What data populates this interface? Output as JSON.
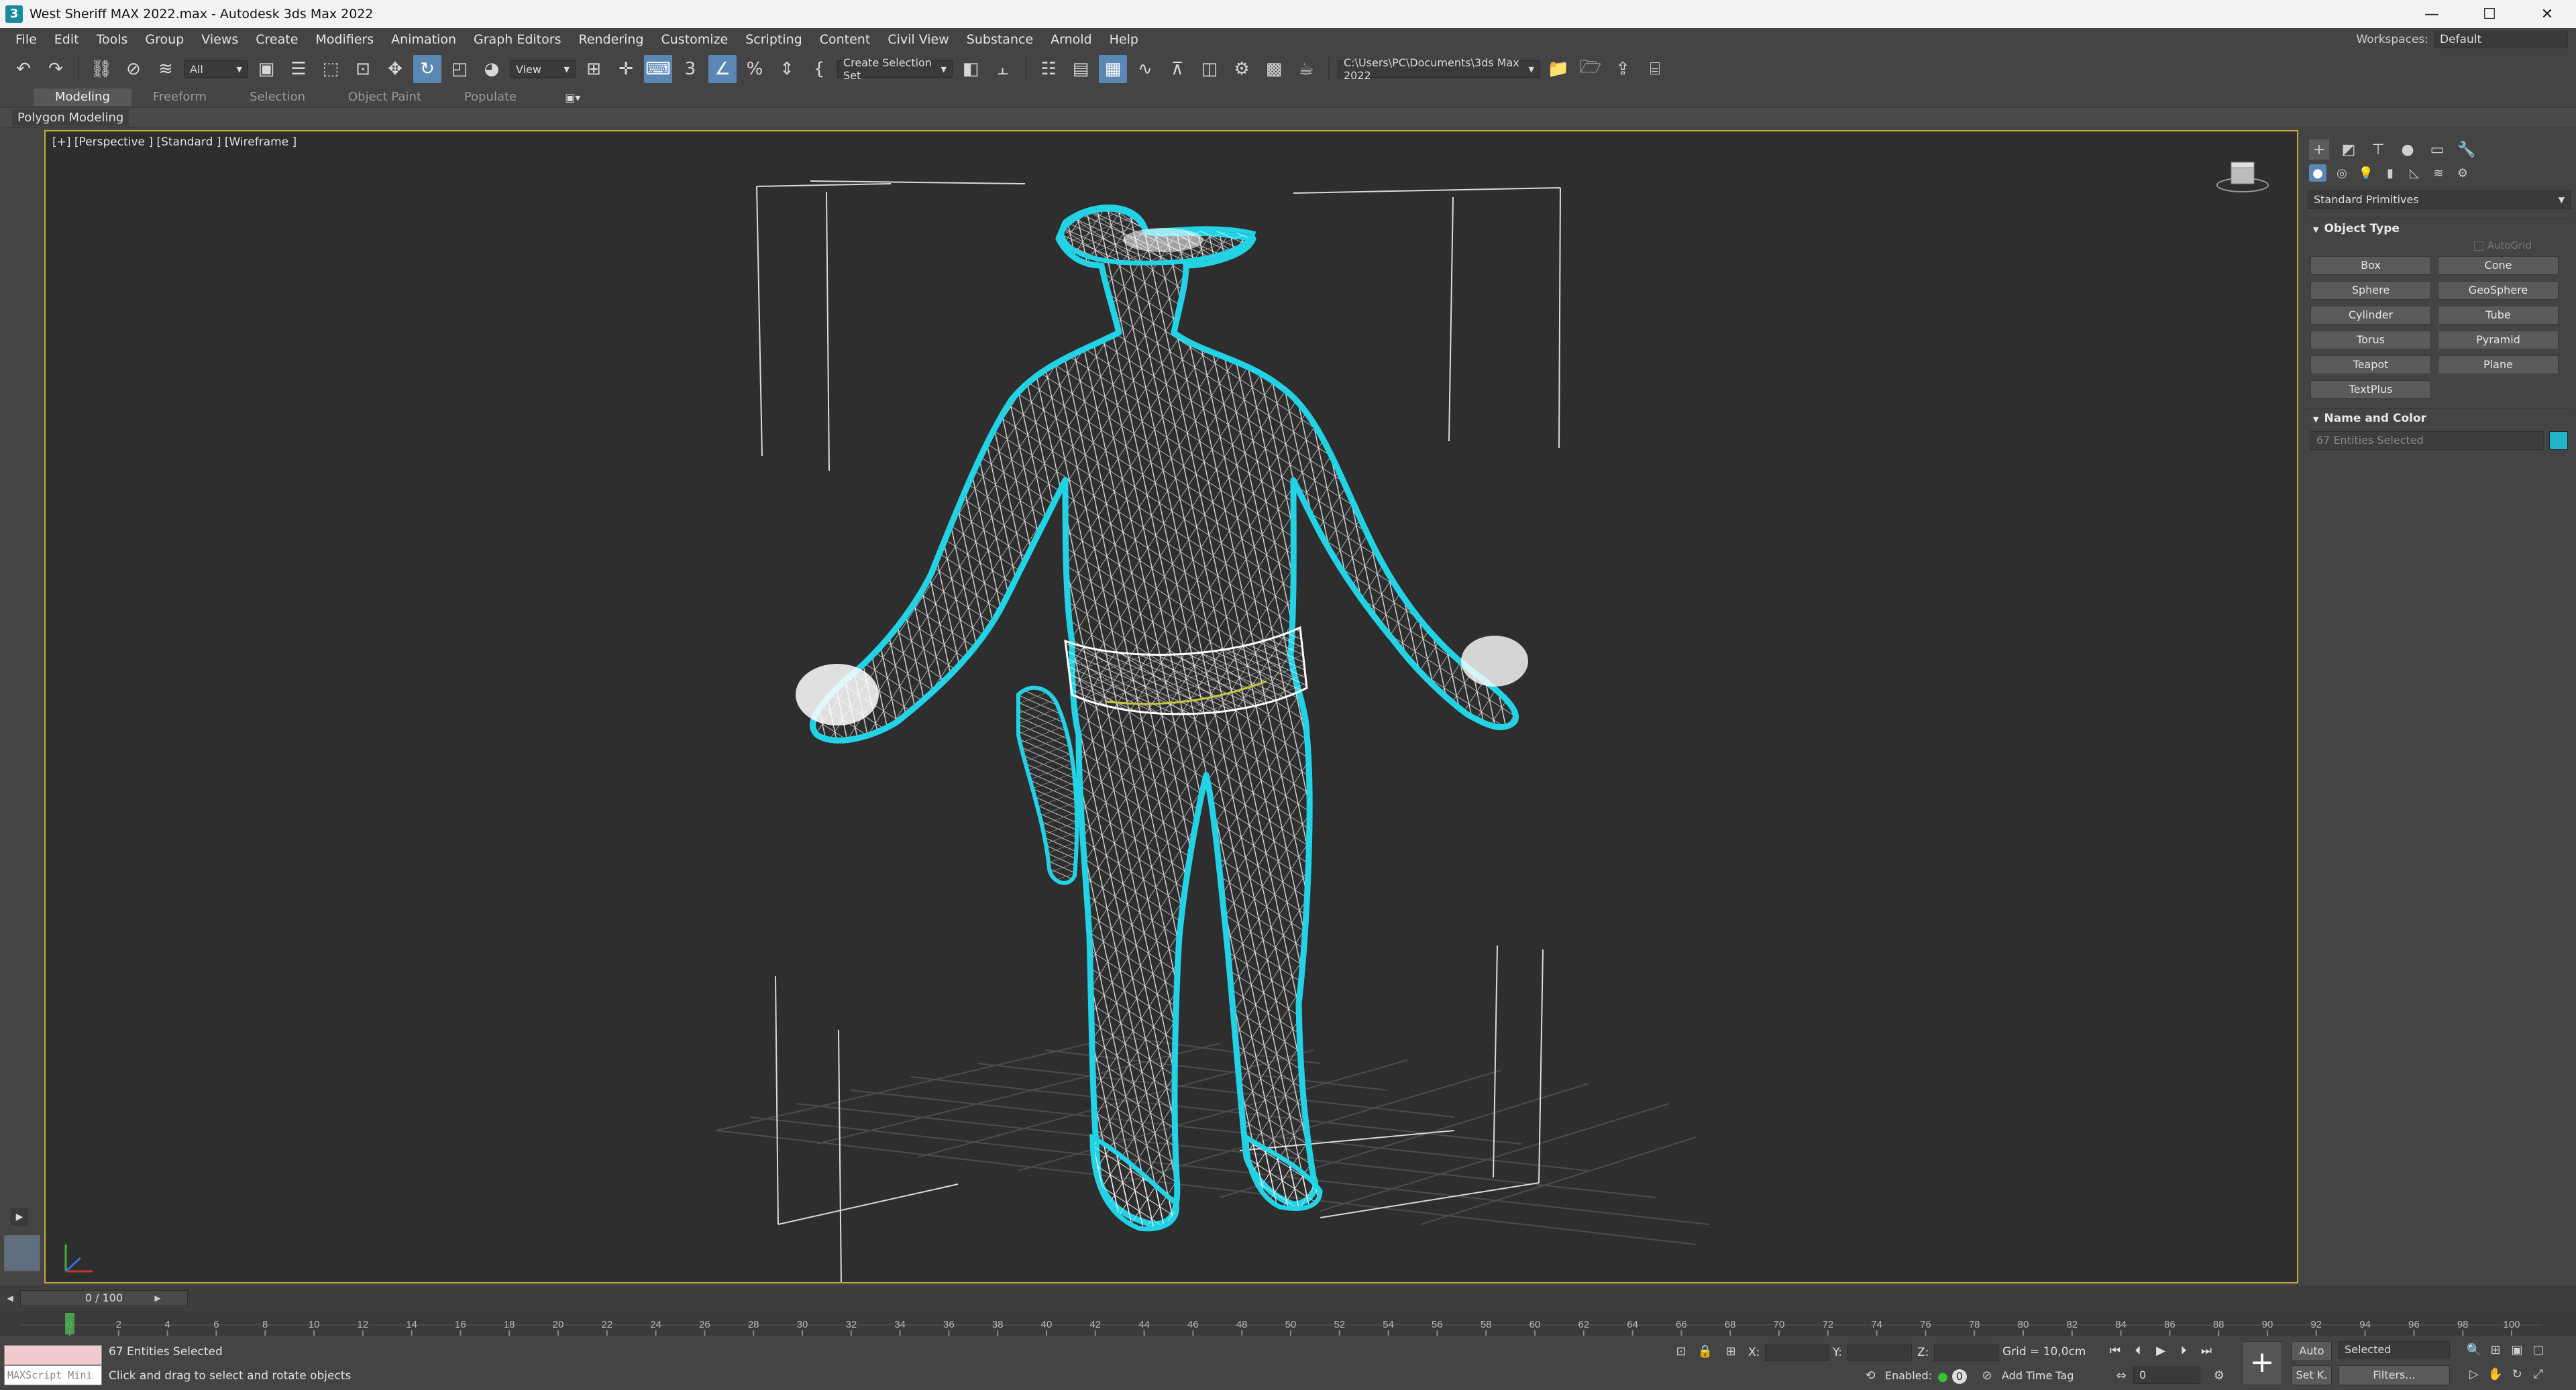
{
  "window": {
    "title": "West Sheriff MAX 2022.max - Autodesk 3ds Max 2022",
    "controls": [
      "—",
      "☐",
      "✕"
    ]
  },
  "menubar": {
    "items": [
      "File",
      "Edit",
      "Tools",
      "Group",
      "Views",
      "Create",
      "Modifiers",
      "Animation",
      "Graph Editors",
      "Rendering",
      "Customize",
      "Scripting",
      "Content",
      "Civil View",
      "Substance",
      "Arnold",
      "Help"
    ],
    "workspaces_label": "Workspaces:",
    "workspace_value": "Default"
  },
  "toolbar": {
    "selection_filter": "All",
    "ref_coord": "View",
    "named_selection_set": "Create Selection Set",
    "project_path": "C:\\Users\\PC\\Documents\\3ds Max 2022"
  },
  "ribbon": {
    "tabs": [
      "Modeling",
      "Freeform",
      "Selection",
      "Object Paint",
      "Populate"
    ],
    "active_tab": "Modeling",
    "panel_label": "Polygon Modeling"
  },
  "viewport": {
    "label": "[+] [Perspective ] [Standard ] [Wireframe ]",
    "selection_color": "#22d3e6",
    "wire_color": "#ffffff"
  },
  "command_panel": {
    "primitive_type": "Standard Primitives",
    "object_type_title": "Object Type",
    "autogrid_label": "AutoGrid",
    "buttons": [
      "Box",
      "Cone",
      "Sphere",
      "GeoSphere",
      "Cylinder",
      "Tube",
      "Torus",
      "Pyramid",
      "Teapot",
      "Plane",
      "TextPlus"
    ],
    "name_color_title": "Name and Color",
    "name_value": "67 Entities Selected",
    "object_color": "#22b5c8"
  },
  "timeline": {
    "frame_display": "0 / 100",
    "ticks": [
      "0",
      "2",
      "4",
      "6",
      "8",
      "10",
      "12",
      "14",
      "16",
      "18",
      "20",
      "22",
      "24",
      "26",
      "28",
      "30",
      "32",
      "34",
      "36",
      "38",
      "40",
      "42",
      "44",
      "46",
      "48",
      "50",
      "52",
      "54",
      "56",
      "58",
      "60",
      "62",
      "64",
      "66",
      "68",
      "70",
      "72",
      "74",
      "76",
      "78",
      "80",
      "82",
      "84",
      "86",
      "88",
      "90",
      "92",
      "94",
      "96",
      "98",
      "100"
    ]
  },
  "status": {
    "maxscript_label": "MAXScript Mini",
    "selection_info": "67 Entities Selected",
    "prompt": "Click and drag to select and rotate objects",
    "x_label": "X:",
    "y_label": "Y:",
    "z_label": "Z:",
    "grid": "Grid = 10,0cm",
    "enabled_label": "Enabled:",
    "enabled_value": "0",
    "add_time_tag": "Add Time Tag",
    "auto_label": "Auto",
    "key_mode": "Selected",
    "set_key": "Set K.",
    "filters": "Filters...",
    "current_frame": "0"
  }
}
